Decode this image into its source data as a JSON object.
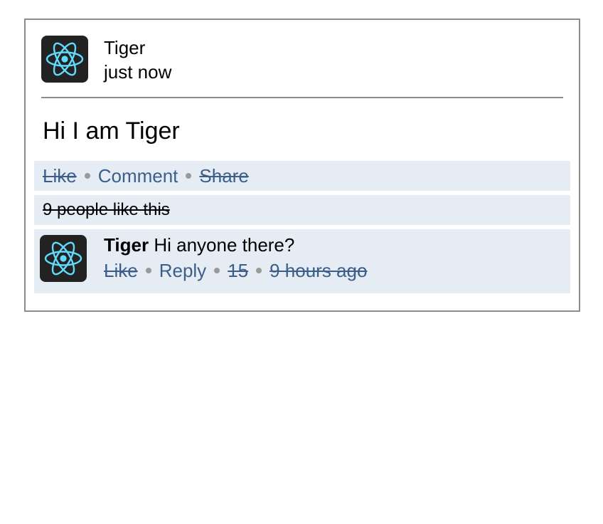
{
  "post": {
    "author": "Tiger",
    "timestamp": "just now",
    "avatar_icon": "react-atom-icon",
    "message": "Hi I am Tiger"
  },
  "actions": {
    "like": "Like",
    "comment": "Comment",
    "share": "Share"
  },
  "likes_summary": "9 people like this",
  "comment": {
    "author": "Tiger",
    "text": " Hi anyone there?",
    "avatar_icon": "react-atom-icon",
    "like": "Like",
    "reply": "Reply",
    "like_count": "15",
    "time": "9 hours ago"
  },
  "colors": {
    "band": "#e5ecf3",
    "link": "#3b5f8a",
    "avatar_bg": "#222222",
    "atom": "#61dafb",
    "border": "#8c8c8c"
  }
}
